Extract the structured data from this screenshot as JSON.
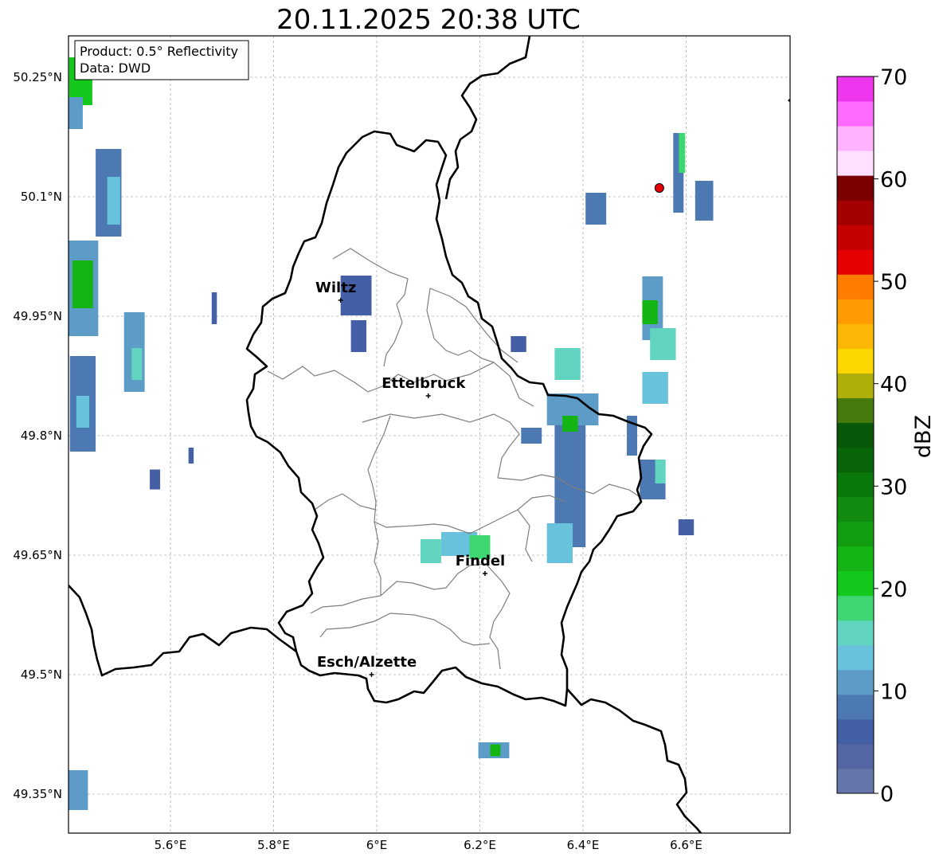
{
  "title": "20.11.2025 20:38 UTC",
  "info_box": {
    "line1": "Product: 0.5° Reflectivity",
    "line2": "Data: DWD"
  },
  "map": {
    "lon_range": [
      5.4,
      6.8
    ],
    "lat_range": [
      49.3,
      50.3
    ],
    "lat_ticks": [
      {
        "value": 50.25,
        "label": "50.25°N"
      },
      {
        "value": 50.1,
        "label": "50.1°N"
      },
      {
        "value": 49.95,
        "label": "49.95°N"
      },
      {
        "value": 49.8,
        "label": "49.8°N"
      },
      {
        "value": 49.65,
        "label": "49.65°N"
      },
      {
        "value": 49.5,
        "label": "49.5°N"
      },
      {
        "value": 49.35,
        "label": "49.35°N"
      }
    ],
    "lon_ticks": [
      {
        "value": 5.6,
        "label": "5.6°E"
      },
      {
        "value": 5.8,
        "label": "5.8°E"
      },
      {
        "value": 6.0,
        "label": "6°E"
      },
      {
        "value": 6.2,
        "label": "6.2°E"
      },
      {
        "value": 6.4,
        "label": "6.4°E"
      },
      {
        "value": 6.6,
        "label": "6.6°E"
      }
    ],
    "cities": [
      {
        "name": "Wiltz",
        "lon": 5.93,
        "lat": 49.97
      },
      {
        "name": "Ettelbruck",
        "lon": 6.1,
        "lat": 49.85
      },
      {
        "name": "Findel",
        "lon": 6.21,
        "lat": 49.627
      },
      {
        "name": "Esch/Alzette",
        "lon": 5.99,
        "lat": 49.5
      }
    ],
    "radar_site": {
      "lon": 6.548,
      "lat": 50.111,
      "color": "#e60000"
    }
  },
  "colorbar": {
    "label": "dBZ",
    "min": 0,
    "max": 70,
    "ticks": [
      {
        "value": 0,
        "label": "0"
      },
      {
        "value": 10,
        "label": "10"
      },
      {
        "value": 20,
        "label": "20"
      },
      {
        "value": 30,
        "label": "30"
      },
      {
        "value": 40,
        "label": "40"
      },
      {
        "value": 50,
        "label": "50"
      },
      {
        "value": 60,
        "label": "60"
      },
      {
        "value": 70,
        "label": "70"
      }
    ],
    "colors": [
      "#6676ab",
      "#5466a3",
      "#445fa6",
      "#4c79b1",
      "#5d9cc6",
      "#69c2db",
      "#61d5c0",
      "#3dd670",
      "#14c81c",
      "#14b414",
      "#119f11",
      "#118c11",
      "#0b780b",
      "#086408",
      "#085608",
      "#467a0e",
      "#afaf0b",
      "#ffd700",
      "#fcb606",
      "#ff9b00",
      "#ff7c00",
      "#e60000",
      "#c40000",
      "#a30000",
      "#7a0000",
      "#ffe0ff",
      "#ffb3ff",
      "#ff6bff",
      "#ec35ec"
    ]
  },
  "radar_cells": [
    {
      "lon": 5.426,
      "lat": 50.245,
      "w": 0.045,
      "h": 0.06,
      "dbz": 20
    },
    {
      "lon": 5.415,
      "lat": 50.205,
      "w": 0.03,
      "h": 0.04,
      "dbz": 12
    },
    {
      "lon": 5.48,
      "lat": 50.105,
      "w": 0.05,
      "h": 0.11,
      "dbz": 9
    },
    {
      "lon": 5.49,
      "lat": 50.095,
      "w": 0.025,
      "h": 0.06,
      "dbz": 14
    },
    {
      "lon": 5.43,
      "lat": 49.985,
      "w": 0.06,
      "h": 0.12,
      "dbz": 12
    },
    {
      "lon": 5.43,
      "lat": 49.99,
      "w": 0.04,
      "h": 0.06,
      "dbz": 22
    },
    {
      "lon": 5.43,
      "lat": 49.84,
      "w": 0.05,
      "h": 0.12,
      "dbz": 9
    },
    {
      "lon": 5.43,
      "lat": 49.83,
      "w": 0.025,
      "h": 0.04,
      "dbz": 14
    },
    {
      "lon": 5.53,
      "lat": 49.905,
      "w": 0.04,
      "h": 0.1,
      "dbz": 11
    },
    {
      "lon": 5.535,
      "lat": 49.89,
      "w": 0.02,
      "h": 0.04,
      "dbz": 15
    },
    {
      "lon": 5.42,
      "lat": 49.355,
      "w": 0.04,
      "h": 0.05,
      "dbz": 12
    },
    {
      "lon": 5.96,
      "lat": 49.976,
      "w": 0.06,
      "h": 0.05,
      "dbz": 6
    },
    {
      "lon": 5.965,
      "lat": 49.925,
      "w": 0.03,
      "h": 0.04,
      "dbz": 5
    },
    {
      "lon": 6.375,
      "lat": 49.74,
      "w": 0.06,
      "h": 0.16,
      "dbz": 8
    },
    {
      "lon": 6.3,
      "lat": 49.8,
      "w": 0.04,
      "h": 0.02,
      "dbz": 9
    },
    {
      "lon": 6.355,
      "lat": 49.665,
      "w": 0.05,
      "h": 0.05,
      "dbz": 14
    },
    {
      "lon": 6.16,
      "lat": 49.664,
      "w": 0.07,
      "h": 0.03,
      "dbz": 13
    },
    {
      "lon": 6.105,
      "lat": 49.655,
      "w": 0.04,
      "h": 0.03,
      "dbz": 15
    },
    {
      "lon": 6.2,
      "lat": 49.66,
      "w": 0.04,
      "h": 0.03,
      "dbz": 17
    },
    {
      "lon": 6.38,
      "lat": 49.833,
      "w": 0.1,
      "h": 0.04,
      "dbz": 10
    },
    {
      "lon": 6.375,
      "lat": 49.815,
      "w": 0.03,
      "h": 0.02,
      "dbz": 22
    },
    {
      "lon": 6.37,
      "lat": 49.89,
      "w": 0.05,
      "h": 0.04,
      "dbz": 15
    },
    {
      "lon": 6.535,
      "lat": 49.96,
      "w": 0.04,
      "h": 0.08,
      "dbz": 12
    },
    {
      "lon": 6.53,
      "lat": 49.955,
      "w": 0.03,
      "h": 0.03,
      "dbz": 22
    },
    {
      "lon": 6.555,
      "lat": 49.915,
      "w": 0.05,
      "h": 0.04,
      "dbz": 15
    },
    {
      "lon": 6.54,
      "lat": 49.86,
      "w": 0.05,
      "h": 0.04,
      "dbz": 14
    },
    {
      "lon": 6.495,
      "lat": 49.8,
      "w": 0.02,
      "h": 0.05,
      "dbz": 8
    },
    {
      "lon": 6.535,
      "lat": 49.745,
      "w": 0.05,
      "h": 0.05,
      "dbz": 9
    },
    {
      "lon": 6.55,
      "lat": 49.755,
      "w": 0.02,
      "h": 0.03,
      "dbz": 16
    },
    {
      "lon": 6.6,
      "lat": 49.685,
      "w": 0.03,
      "h": 0.02,
      "dbz": 6
    },
    {
      "lon": 6.425,
      "lat": 50.085,
      "w": 0.04,
      "h": 0.04,
      "dbz": 9
    },
    {
      "lon": 6.585,
      "lat": 50.13,
      "w": 0.02,
      "h": 0.1,
      "dbz": 9
    },
    {
      "lon": 6.592,
      "lat": 50.155,
      "w": 0.012,
      "h": 0.05,
      "dbz": 19
    },
    {
      "lon": 6.635,
      "lat": 50.095,
      "w": 0.035,
      "h": 0.05,
      "dbz": 8
    },
    {
      "lon": 6.227,
      "lat": 49.405,
      "w": 0.06,
      "h": 0.02,
      "dbz": 12
    },
    {
      "lon": 6.23,
      "lat": 49.405,
      "w": 0.02,
      "h": 0.015,
      "dbz": 22
    },
    {
      "lon": 6.275,
      "lat": 49.915,
      "w": 0.03,
      "h": 0.02,
      "dbz": 7
    },
    {
      "lon": 5.685,
      "lat": 49.96,
      "w": 0.01,
      "h": 0.04,
      "dbz": 6
    },
    {
      "lon": 5.57,
      "lat": 49.745,
      "w": 0.02,
      "h": 0.025,
      "dbz": 6
    },
    {
      "lon": 5.64,
      "lat": 49.775,
      "w": 0.01,
      "h": 0.02,
      "dbz": 7
    }
  ]
}
